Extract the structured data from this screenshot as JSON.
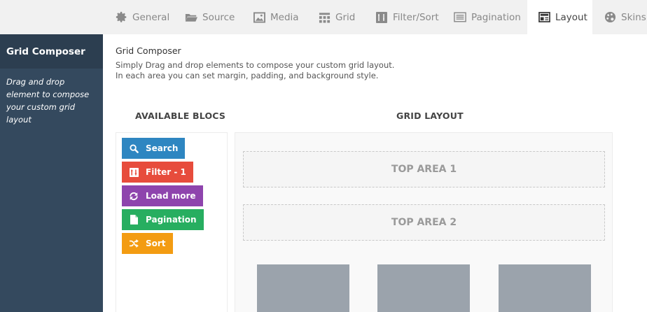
{
  "tabs": [
    {
      "label": "General",
      "icon": "gear-icon"
    },
    {
      "label": "Source",
      "icon": "folder-icon"
    },
    {
      "label": "Media",
      "icon": "image-icon"
    },
    {
      "label": "Grid",
      "icon": "grid-icon"
    },
    {
      "label": "Filter/Sort",
      "icon": "filter-icon"
    },
    {
      "label": "Pagination",
      "icon": "pagination-icon"
    },
    {
      "label": "Layout",
      "icon": "layout-icon",
      "active": true
    },
    {
      "label": "Skins",
      "icon": "palette-icon"
    }
  ],
  "sidebar": {
    "title": "Grid Composer",
    "description": "Drag and drop element to compose your custom grid layout"
  },
  "main": {
    "title": "Grid Composer",
    "description_line1": "Simply Drag and drop elements to compose your custom grid layout.",
    "description_line2": "In each area you can set margin, padding, and background style.",
    "available_heading": "AVAILABLE BLOCS",
    "layout_heading": "GRID LAYOUT",
    "blocs": [
      {
        "label": "Search",
        "icon": "search-icon",
        "color": "#2e86c1"
      },
      {
        "label": "Filter - 1",
        "icon": "filter-icon",
        "color": "#e74c3c"
      },
      {
        "label": "Load more",
        "icon": "refresh-icon",
        "color": "#8e44ad"
      },
      {
        "label": "Pagination",
        "icon": "document-icon",
        "color": "#27ae60"
      },
      {
        "label": "Sort",
        "icon": "shuffle-icon",
        "color": "#f39c12"
      }
    ],
    "areas": [
      {
        "label": "TOP AREA 1"
      },
      {
        "label": "TOP AREA 2"
      }
    ]
  },
  "colors": {
    "sidebar_bg": "#34495e",
    "sidebar_title_bg": "#2c3e50",
    "tabbar_bg": "#f1f1f1",
    "thumb": "#9ba3ac"
  }
}
